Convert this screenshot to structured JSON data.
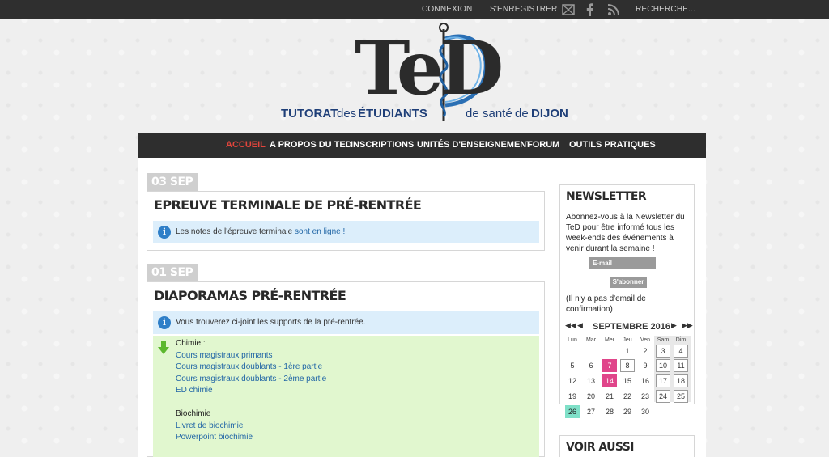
{
  "topbar": {
    "login": "CONNEXION",
    "register": "S'ENREGISTRER",
    "search": "RECHERCHE..."
  },
  "logo": {
    "mark": "TeD",
    "tag_part1": "TUTORAT",
    "tag_part2": "des",
    "tag_part3": "ÉTUDIANTS",
    "tag_part4": "de",
    "tag_part5": "santé",
    "tag_part6": "de",
    "tag_part7": "DIJON"
  },
  "nav": {
    "items": [
      "ACCUEIL",
      "A PROPOS DU TED",
      "INSCRIPTIONS",
      "UNITÉS D'ENSEIGNEMENT",
      "FORUM",
      "OUTILS PRATIQUES"
    ]
  },
  "posts": [
    {
      "date": "03 SEP",
      "title": "EPREUVE TERMINALE DE PRÉ-RENTRÉE",
      "info_text": "Les notes de l'épreuve terminale ",
      "info_link": "sont en ligne !"
    },
    {
      "date": "01 SEP",
      "title": "DIAPORAMAS PRÉ-RENTRÉE",
      "info_text": "Vous trouverez ci-joint les supports de la pré-rentrée.",
      "sections": [
        {
          "heading": "Chimie :",
          "links": [
            "Cours magistraux primants",
            "Cours magistraux doublants - 1ère partie",
            "Cours magistraux doublants - 2ème partie",
            "ED chimie"
          ]
        },
        {
          "heading": "Biochimie",
          "links": [
            "Livret de biochimie",
            "Powerpoint biochimie"
          ]
        }
      ]
    }
  ],
  "newsletter": {
    "title": "NEWSLETTER",
    "lines": [
      "Abonnez-vous à la Newsletter du",
      "TeD pour être informé tous les",
      "week-ends des événements à",
      "venir durant la semaine !"
    ],
    "email_placeholder": "E-mail",
    "subscribe": "S'abonner",
    "note_lines": [
      "(Il n'y a pas d'email de",
      "confirmation)"
    ]
  },
  "calendar": {
    "month": "SEPTEMBRE 2016",
    "prev_year": "◀◀",
    "prev": "◀",
    "next": "▶",
    "next_year": "▶▶",
    "days_of_week": [
      "Lun",
      "Mar",
      "Mer",
      "Jeu",
      "Ven",
      "Sam",
      "Dim"
    ],
    "weeks": [
      [
        "",
        "",
        "",
        "1",
        "2",
        "3",
        "4"
      ],
      [
        "5",
        "6",
        "7",
        "8",
        "9",
        "10",
        "11"
      ],
      [
        "12",
        "13",
        "14",
        "15",
        "16",
        "17",
        "18"
      ],
      [
        "19",
        "20",
        "21",
        "22",
        "23",
        "24",
        "25"
      ],
      [
        "26",
        "27",
        "28",
        "29",
        "30",
        "",
        ""
      ]
    ],
    "highlighted_pink": [
      "7",
      "14"
    ],
    "today": "26",
    "boxed": [
      "8"
    ]
  },
  "see_also": {
    "title": "VOIR AUSSI"
  },
  "colors": {
    "topbar": "#2f2f2f",
    "nav": "#2e2e2e",
    "nav_active": "#e2453c",
    "info_bg": "#dceefb",
    "green_bg": "#e1f7cf",
    "link": "#2166a6",
    "logo_blue": "#1f3f78",
    "cal_pink": "#e0458a",
    "cal_teal": "#7fe0c8"
  }
}
